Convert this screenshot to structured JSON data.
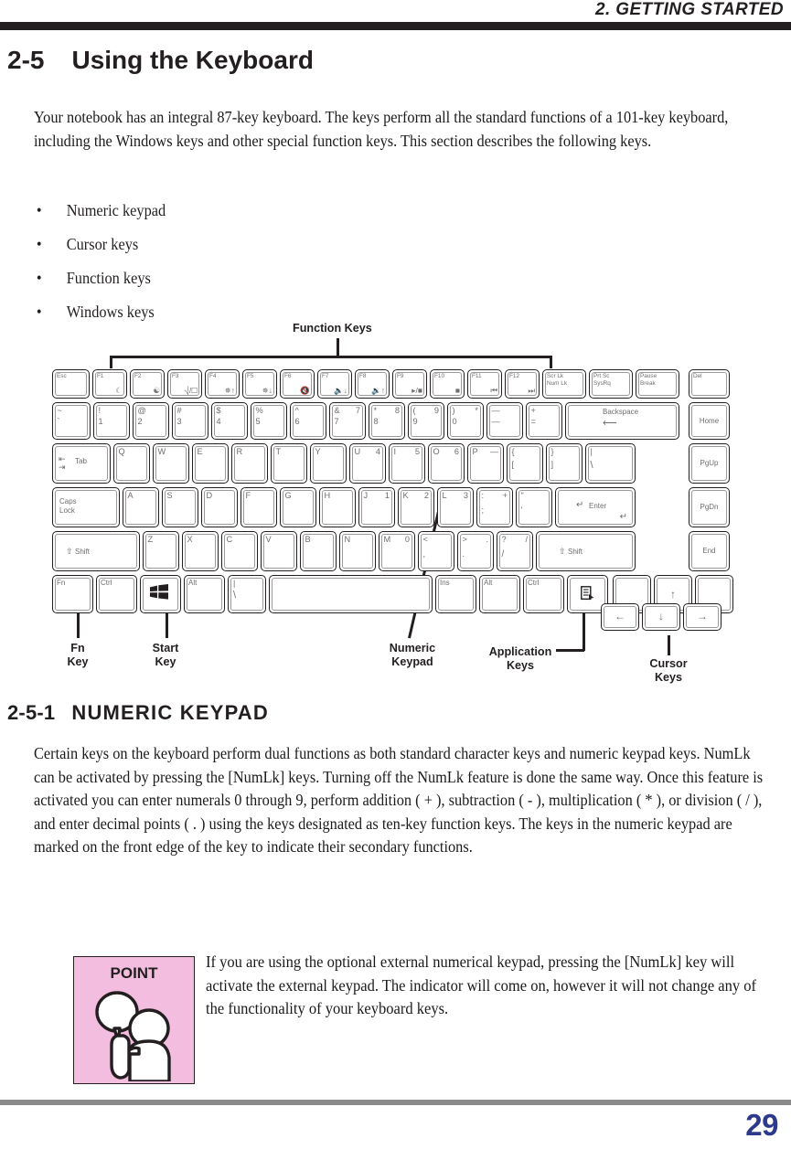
{
  "header": {
    "title": "2. GETTING STARTED"
  },
  "section": {
    "number": "2-5",
    "title": "Using the Keyboard"
  },
  "subsection": {
    "number": "2-5-1",
    "title": "NUMERIC  KEYPAD"
  },
  "intro": "Your notebook has an integral 87-key keyboard. The keys perform all the standard functions of a 101-key keyboard, including the Windows keys and other special function keys. This section describes the following keys.",
  "bullets": [
    {
      "marker": "•",
      "label": "Numeric keypad"
    },
    {
      "marker": "•",
      "label": "Cursor keys"
    },
    {
      "marker": "•",
      "label": "Function keys"
    },
    {
      "marker": "•",
      "label": "Windows keys"
    }
  ],
  "numeric_body": "Certain keys on the keyboard perform dual functions as both standard character keys and numeric keypad keys. NumLk can be activated by pressing the [NumLk] keys. Turning off the NumLk feature is done the same way. Once this feature is activated you can enter numerals 0 through 9, perform addition ( + ), subtraction ( - ), multiplication ( * ), or division ( / ), and enter decimal points ( . ) using the keys designated as ten-key function keys. The keys in the numeric keypad are marked on the front edge of the key to indicate their secondary functions.",
  "point": {
    "label": "POINT",
    "text": " If you are using the optional external numerical keypad, pressing the [NumLk] key will activate the external keypad. The indicator will come on, however it will not change any of the functionality of your keyboard keys.",
    "bg_color": "#f2bdde"
  },
  "footer": {
    "page_number": "29",
    "rule_color": "#8a8a8a",
    "page_number_color": "#2d3a8c"
  },
  "diagram": {
    "callouts": [
      {
        "id": "function-keys",
        "label": "Function Keys"
      },
      {
        "id": "fn-key",
        "label": "Fn\nKey"
      },
      {
        "id": "start-key",
        "label": "Start\nKey"
      },
      {
        "id": "numeric-keypad",
        "label": "Numeric\nKeypad"
      },
      {
        "id": "application-keys",
        "label": "Application\nKeys"
      },
      {
        "id": "cursor-keys",
        "label": "Cursor\nKeys"
      }
    ],
    "rows": {
      "function_row": [
        "Esc",
        "F1",
        "F2",
        "F3",
        "F4",
        "F5",
        "F6",
        "F7",
        "F8",
        "F9",
        "F10",
        "F11",
        "F12",
        "Scr Lk / Num Lk",
        "Prt Sc / SysRq",
        "Pause / Break",
        "Del"
      ],
      "number_row": [
        "~ `",
        "! 1",
        "@ 2",
        "# 3",
        "$ 4",
        "% 5",
        "^ 6",
        "& 7 / 7",
        "* 8 / 8",
        "( 9 / 9",
        ") * / 0",
        "_ -",
        "+ =",
        "Backspace",
        "Home"
      ],
      "qwerty_row": [
        "Tab",
        "Q",
        "W",
        "E",
        "R",
        "T",
        "Y",
        "U 4",
        "I 5",
        "O 6",
        "P -",
        "{ [",
        "} ]",
        ": \\",
        "PgUp"
      ],
      "home_row": [
        "Caps Lock",
        "A",
        "S",
        "D",
        "F",
        "G",
        "H",
        "J 1",
        "K 2",
        "L 3",
        ": + ;",
        "\" ,",
        "Enter",
        "PgDn"
      ],
      "shift_row": [
        "Shift",
        "Z",
        "X",
        "C",
        "V",
        "B",
        "N",
        "M 0",
        "< ,",
        "> .",
        "? /",
        "Shift",
        "End"
      ],
      "bottom_row": [
        "Fn",
        "Ctrl",
        "Start",
        "Alt",
        "Space",
        "Ins",
        "Alt",
        "Ctrl",
        "Application",
        "Up",
        "Left",
        "Down",
        "Right"
      ]
    }
  }
}
